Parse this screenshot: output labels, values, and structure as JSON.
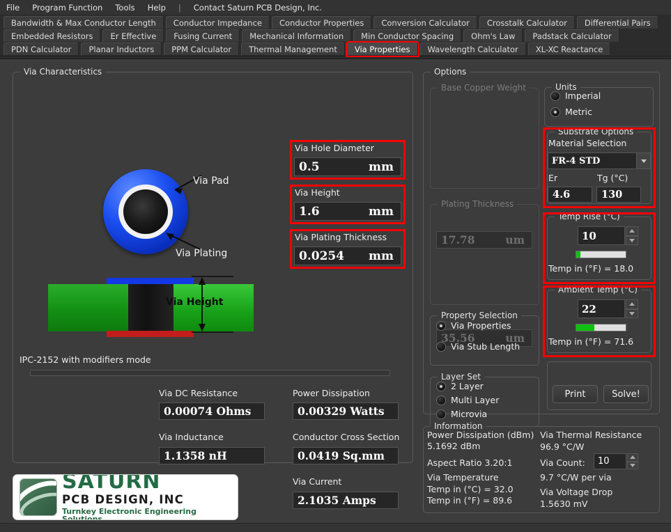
{
  "menu": {
    "items": [
      "File",
      "Program Function",
      "Tools",
      "Help"
    ],
    "separator": "|",
    "contact": "Contact Saturn PCB Design, Inc."
  },
  "tabs": {
    "row1": [
      "Bandwidth & Max Conductor Length",
      "Conductor Impedance",
      "Conductor Properties",
      "Conversion Calculator",
      "Crosstalk Calculator",
      "Differential Pairs"
    ],
    "row2": [
      "Embedded Resistors",
      "Er Effective",
      "Fusing Current",
      "Mechanical Information",
      "Min Conductor Spacing",
      "Ohm's Law",
      "Padstack Calculator"
    ],
    "row3": [
      "PDN Calculator",
      "Planar Inductors",
      "PPM Calculator",
      "Thermal Management",
      "Via Properties",
      "Wavelength Calculator",
      "XL-XC Reactance"
    ],
    "active": "Via Properties"
  },
  "via_characteristics": {
    "legend": "Via Characteristics",
    "callout_pad": "Via Pad",
    "callout_plating": "Via Plating",
    "callout_height": "Via Height",
    "mode_text": "IPC-2152 with modifiers mode",
    "inputs": [
      {
        "label": "Via Hole Diameter",
        "value": "0.5",
        "unit": "mm"
      },
      {
        "label": "Via Height",
        "value": "1.6",
        "unit": "mm"
      },
      {
        "label": "Via Plating Thickness",
        "value": "0.0254",
        "unit": "mm"
      }
    ],
    "results": [
      {
        "label": "Via DC Resistance",
        "value": "0.00074 Ohms"
      },
      {
        "label": "Via Inductance",
        "value": "1.1358 nH"
      },
      {
        "label": "Power Dissipation",
        "value": "0.00329 Watts"
      },
      {
        "label": "Conductor Cross Section",
        "value": "0.0419 Sq.mm"
      },
      {
        "label": "Via Current",
        "value": "2.1035 Amps"
      }
    ]
  },
  "options": {
    "legend": "Options",
    "base_copper_weight": {
      "legend": "Base Copper Weight",
      "value": "17.78",
      "unit": "um"
    },
    "plating_thickness": {
      "legend": "Plating Thickness",
      "value": "35.56",
      "unit": "um"
    },
    "units": {
      "legend": "Units",
      "options": [
        "Imperial",
        "Metric"
      ],
      "selected": "Metric"
    },
    "substrate": {
      "legend": "Substrate Options",
      "material_label": "Material Selection",
      "material_value": "FR-4 STD",
      "er_label": "Er",
      "er_value": "4.6",
      "tg_label": "Tg (°C)",
      "tg_value": "130"
    },
    "temp_rise": {
      "legend": "Temp Rise (°C)",
      "value": "10",
      "bar_percent": 8,
      "fahrenheit": "Temp in (°F) = 18.0"
    },
    "ambient_temp": {
      "legend": "Ambient Temp (°C)",
      "value": "22",
      "bar_percent": 36,
      "fahrenheit": "Temp in (°F) = 71.6"
    },
    "property_selection": {
      "legend": "Property Selection",
      "options": [
        "Via Properties",
        "Via Stub Length"
      ],
      "selected": "Via Properties"
    },
    "layer_set": {
      "legend": "Layer Set",
      "options": [
        "2 Layer",
        "Multi Layer",
        "Microvia"
      ],
      "selected": "2 Layer"
    },
    "buttons": {
      "print": "Print",
      "solve": "Solve!"
    }
  },
  "information": {
    "legend": "Information",
    "left": [
      "Power Dissipation (dBm)",
      "5.1692 dBm",
      "Aspect Ratio   3.20:1",
      "Via Temperature",
      "Temp in (°C) = 32.0",
      "Temp in (°F) = 89.6"
    ],
    "right_thermal_label": "Via Thermal Resistance",
    "right_thermal_value": "96.9 °C/W",
    "via_count_label": "Via Count:",
    "via_count_value": "10",
    "per_via": "9.7 °C/W per via",
    "voltage_drop_label": "Via Voltage Drop",
    "voltage_drop_value": "1.5630 mV"
  },
  "logo": {
    "line1": "SATURN",
    "line2": "PCB DESIGN, INC",
    "line3": "Turnkey Electronic Engineering Solutions"
  },
  "colors": {
    "accent_red": "#fb0000",
    "progress_green": "#10c010",
    "pad_blue": "#1a4ef0",
    "substrate_green": "#139013",
    "logo_green": "#236b45"
  }
}
